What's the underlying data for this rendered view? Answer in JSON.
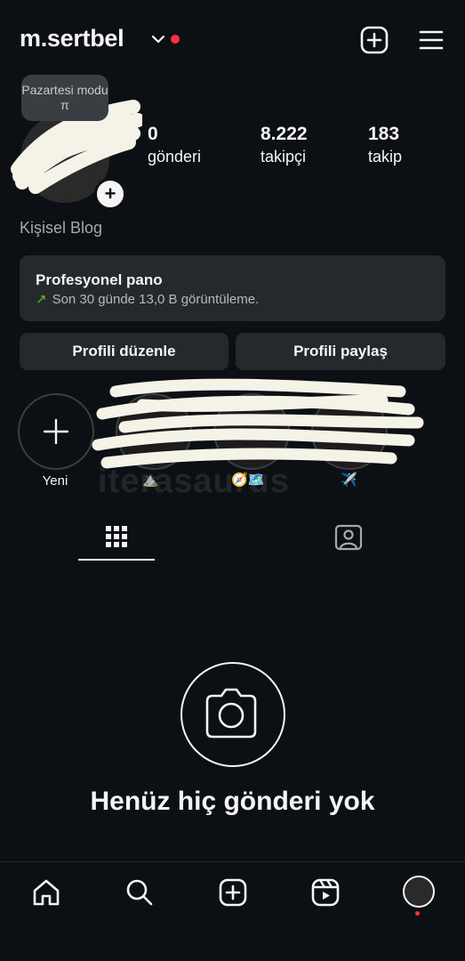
{
  "header": {
    "username": "m.sertbel",
    "accent_red": "#ff3040",
    "icons": [
      "chevron-down-icon",
      "create-icon",
      "menu-icon"
    ]
  },
  "profile": {
    "note": "Pazartesi modu π",
    "stats": [
      {
        "value": "0",
        "label": "gönderi"
      },
      {
        "value": "8.222",
        "label": "takipçi"
      },
      {
        "value": "183",
        "label": "takip"
      }
    ],
    "bio": "Kişisel Blog"
  },
  "pro_panel": {
    "title": "Profesyonel pano",
    "subtitle": "Son 30 günde 13,0 B görüntüleme.",
    "arrow": "↗",
    "accent": "#58c322"
  },
  "buttons": {
    "edit": "Profili düzenle",
    "share": "Profili paylaş"
  },
  "highlights": {
    "new_label": "Yeni",
    "emojis": [
      "⛰️",
      "🧭🗺️",
      "✈️"
    ]
  },
  "watermark": "iterasaurus",
  "empty": {
    "title": "Henüz hiç gönderi yok"
  },
  "nav": {
    "icons": [
      "home-icon",
      "search-icon",
      "create-icon",
      "reels-icon",
      "profile-avatar"
    ]
  }
}
